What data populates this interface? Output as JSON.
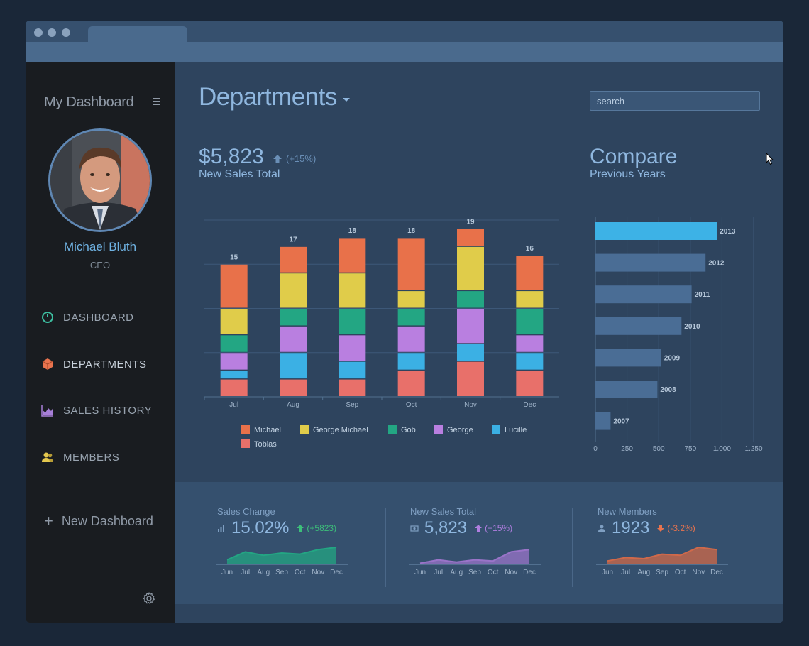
{
  "sidebar": {
    "brand": "My Dashboard",
    "user": {
      "name": "Michael Bluth",
      "role": "CEO"
    },
    "nav": [
      {
        "label": "DASHBOARD",
        "icon": "gauge-icon",
        "color": "#3dbfa1"
      },
      {
        "label": "DEPARTMENTS",
        "icon": "cube-icon",
        "color": "#e8734e"
      },
      {
        "label": "SALES HISTORY",
        "icon": "area-chart-icon",
        "color": "#a77fd8"
      },
      {
        "label": "MEMBERS",
        "icon": "users-icon",
        "color": "#e4c84e"
      }
    ],
    "new_dashboard": "New Dashboard"
  },
  "header": {
    "title": "Departments",
    "search": {
      "placeholder": "search",
      "value": ""
    }
  },
  "sales": {
    "value": "$5,823",
    "delta": "(+15%)",
    "label": "New Sales Total"
  },
  "compare": {
    "title": "Compare",
    "subtitle": "Previous Years"
  },
  "chart_data": [
    {
      "type": "bar",
      "stacked": true,
      "categories": [
        "Jul",
        "Aug",
        "Sep",
        "Oct",
        "Nov",
        "Dec"
      ],
      "totals": [
        "15",
        "17",
        "18",
        "18",
        "19",
        "16"
      ],
      "series": [
        {
          "name": "Tobias",
          "color": "#e8706a",
          "values": [
            2,
            2,
            2,
            3,
            4,
            3
          ]
        },
        {
          "name": "Lucille",
          "color": "#3bb0e4",
          "values": [
            1,
            3,
            2,
            2,
            2,
            2
          ]
        },
        {
          "name": "George",
          "color": "#b97fe0",
          "values": [
            2,
            3,
            3,
            3,
            4,
            2
          ]
        },
        {
          "name": "Gob",
          "color": "#23a683",
          "values": [
            2,
            2,
            3,
            2,
            2,
            3
          ]
        },
        {
          "name": "George Michael",
          "color": "#e0cc4a",
          "values": [
            3,
            4,
            4,
            2,
            5,
            2
          ]
        },
        {
          "name": "Michael",
          "color": "#e8714a",
          "values": [
            5,
            3,
            4,
            6,
            2,
            4
          ]
        }
      ],
      "legend_order": [
        "Michael",
        "George Michael",
        "Gob",
        "George",
        "Lucille",
        "Tobias"
      ],
      "ylim": [
        0,
        20
      ],
      "grid": true,
      "legend": "bottom"
    },
    {
      "type": "bar",
      "orientation": "horizontal",
      "categories": [
        "2013",
        "2012",
        "2011",
        "2010",
        "2009",
        "2008",
        "2007"
      ],
      "values": [
        960,
        870,
        760,
        680,
        520,
        490,
        120
      ],
      "highlight": "2013",
      "highlight_color": "#3db2e6",
      "bar_color": "#4a6d95",
      "xticks": [
        "0",
        "250",
        "500",
        "750",
        "1,000",
        "1,250"
      ],
      "xlim": [
        0,
        1250
      ]
    },
    {
      "type": "area",
      "title": "Sales Change",
      "categories": [
        "Jun",
        "Jul",
        "Aug",
        "Sep",
        "Oct",
        "Nov",
        "Dec"
      ],
      "values": [
        2,
        5.5,
        4,
        5,
        4.5,
        6.5,
        7.5
      ],
      "ylim": [
        0,
        10
      ],
      "color": "#23a683"
    },
    {
      "type": "area",
      "title": "New Sales Total",
      "categories": [
        "Jun",
        "Jul",
        "Aug",
        "Sep",
        "Oct",
        "Nov",
        "Dec"
      ],
      "values": [
        0.5,
        2,
        1,
        2,
        1.5,
        5.5,
        6.5
      ],
      "ylim": [
        0,
        10
      ],
      "color": "#9a74c9"
    },
    {
      "type": "area",
      "title": "New Members",
      "categories": [
        "Jun",
        "Jul",
        "Aug",
        "Sep",
        "Oct",
        "Nov",
        "Dec"
      ],
      "values": [
        1.5,
        3,
        2.5,
        4.5,
        4,
        7.5,
        6.5
      ],
      "ylim": [
        0,
        10
      ],
      "color": "#d0694a"
    }
  ],
  "stats": [
    {
      "title": "Sales Change",
      "value": "15.02%",
      "delta": "(+5823)",
      "direction": "up",
      "delta_color": "#3dbf7a",
      "icon": "bar-chart-icon"
    },
    {
      "title": "New Sales Total",
      "value": "5,823",
      "delta": "(+15%)",
      "direction": "up",
      "delta_color": "#b07ee0",
      "icon": "money-icon"
    },
    {
      "title": "New Members",
      "value": "1923",
      "delta": "(-3.2%)",
      "direction": "down",
      "delta_color": "#e8734e",
      "icon": "user-icon"
    }
  ]
}
